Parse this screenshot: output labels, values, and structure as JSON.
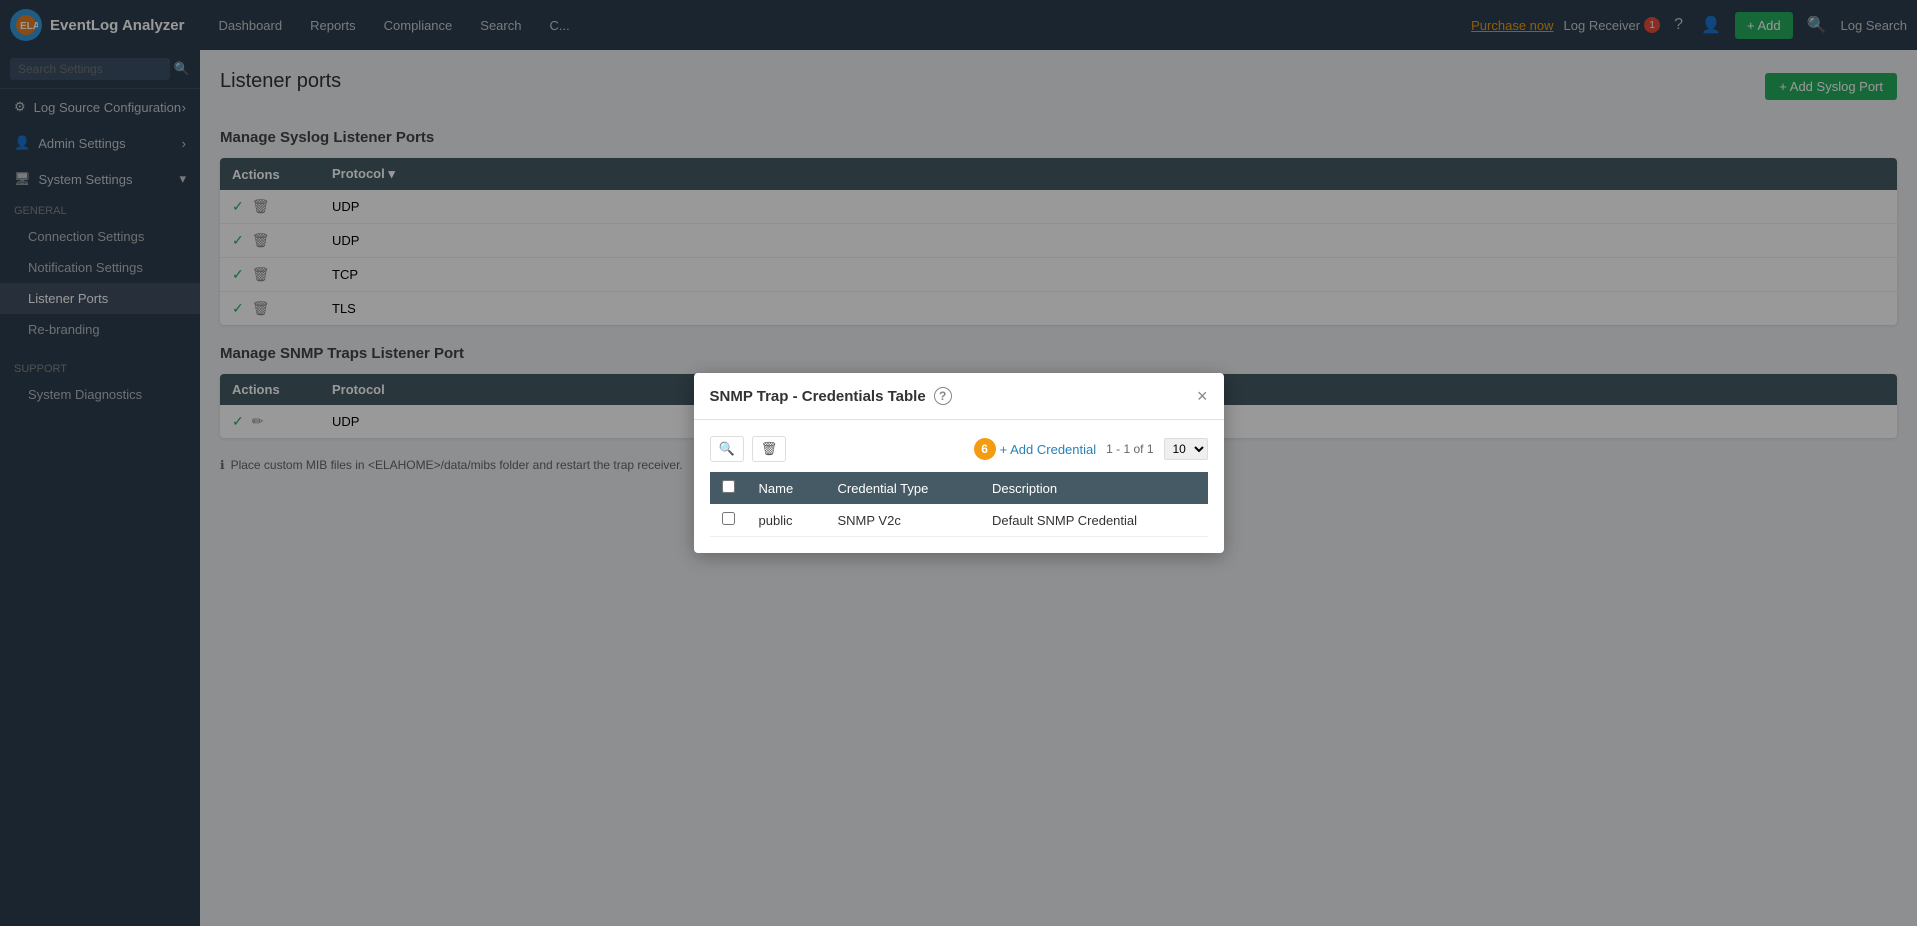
{
  "app": {
    "name": "EventLog Analyzer",
    "logo_text": "ELA"
  },
  "navbar": {
    "nav_items": [
      "Dashboard",
      "Reports",
      "Compliance",
      "Search",
      "C..."
    ],
    "purchase_label": "Purchase now",
    "log_receiver_label": "Log Receiver",
    "notification_count": "1",
    "add_label": "+ Add",
    "log_search_label": "Log Search"
  },
  "sidebar": {
    "search_placeholder": "Search Settings",
    "items": [
      {
        "label": "Log Source Configuration",
        "icon": "⚙",
        "has_submenu": true
      },
      {
        "label": "Admin Settings",
        "icon": "👤",
        "has_submenu": true
      },
      {
        "label": "System Settings",
        "icon": "🖥",
        "has_submenu": true
      }
    ],
    "general_section": "General",
    "general_items": [
      {
        "label": "Connection Settings",
        "active": false
      },
      {
        "label": "Notification Settings",
        "active": false
      },
      {
        "label": "Listener Ports",
        "active": true
      },
      {
        "label": "Re-branding",
        "active": false
      }
    ],
    "support_section": "Support",
    "support_items": [
      {
        "label": "System Diagnostics",
        "active": false
      }
    ]
  },
  "main": {
    "page_title": "Listener ports",
    "syslog_section_title": "Manage Syslog Listener Ports",
    "add_syslog_port_label": "+ Add Syslog Port",
    "syslog_table": {
      "headers": [
        "Actions",
        "Protocol"
      ],
      "rows": [
        {
          "protocol": "UDP",
          "active": true
        },
        {
          "protocol": "UDP",
          "active": true
        },
        {
          "protocol": "TCP",
          "active": true
        },
        {
          "protocol": "TLS",
          "active": true
        }
      ]
    },
    "snmp_section_title": "Manage SNMP Traps Listener Port",
    "snmp_table": {
      "headers": [
        "Actions",
        "Protocol"
      ],
      "rows": [
        {
          "protocol": "UDP",
          "active": true,
          "edit": true
        }
      ]
    },
    "info_text": "Place custom MIB files in <ELAHOME>/data/mibs folder and restart the trap receiver."
  },
  "modal": {
    "title": "SNMP Trap - Credentials Table",
    "close_label": "×",
    "badge_count": "6",
    "add_credential_label": "+ Add Credential",
    "pagination": "1 - 1 of 1",
    "per_page": "10",
    "table": {
      "headers": [
        "",
        "Name",
        "Credential Type",
        "Description"
      ],
      "rows": [
        {
          "name": "public",
          "credential_type": "SNMP V2c",
          "description": "Default SNMP Credential"
        }
      ]
    }
  }
}
